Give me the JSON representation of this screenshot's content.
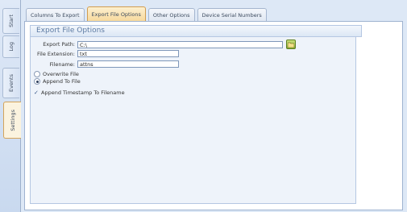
{
  "side_tabs": [
    "Start",
    "Log",
    "Events",
    "Settings"
  ],
  "top_tabs": [
    "Columns To Export",
    "Export File Options",
    "Other Options",
    "Device Serial Numbers"
  ],
  "group_title": "Export File Options",
  "form": {
    "export_path_label": "Export Path:",
    "export_path_value": "C:\\",
    "file_extension_label": "File Extension:",
    "file_extension_value": "txt",
    "filename_label": "Filename:",
    "filename_value": "attns",
    "browse_icon": "folder-browse-icon",
    "overwrite_label": "Overwrite File",
    "overwrite_selected": false,
    "append_label": "Append To File",
    "append_selected": true,
    "timestamp_label": "Append Timestamp To Filename",
    "timestamp_checked": true
  },
  "colors": {
    "active_tab": "#f7d89a",
    "panel_bg": "#eef3fa",
    "header_text": "#5c7aa3"
  }
}
